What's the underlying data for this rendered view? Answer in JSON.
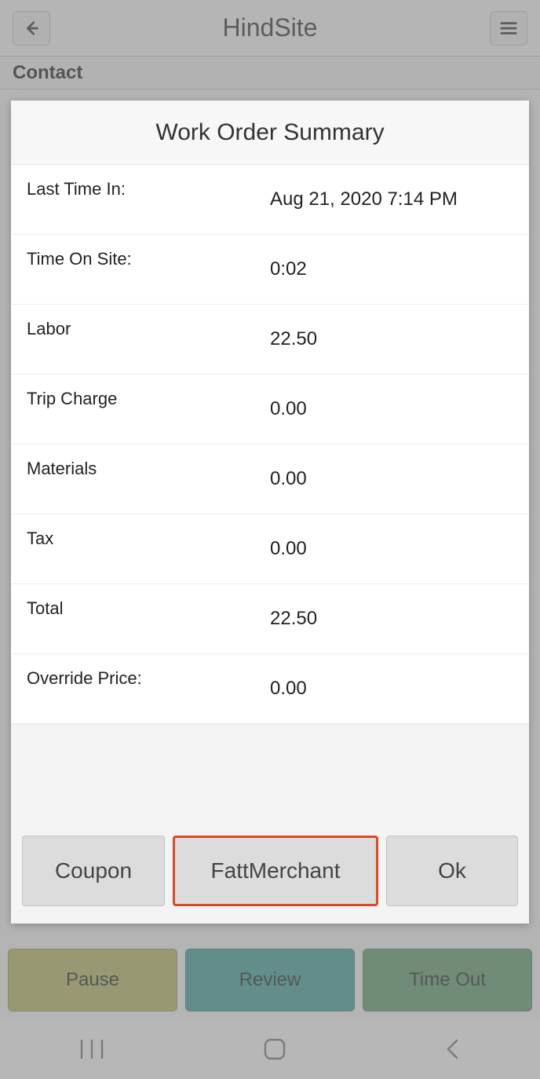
{
  "header": {
    "title": "HindSite"
  },
  "contact": {
    "label": "Contact"
  },
  "modal": {
    "title": "Work Order Summary",
    "rows": [
      {
        "label": "Last Time In:",
        "value": "Aug 21, 2020 7:14 PM"
      },
      {
        "label": "Time On Site:",
        "value": "0:02"
      },
      {
        "label": "Labor",
        "value": "22.50"
      },
      {
        "label": "Trip Charge",
        "value": "0.00"
      },
      {
        "label": "Materials",
        "value": "0.00"
      },
      {
        "label": "Tax",
        "value": "0.00"
      },
      {
        "label": "Total",
        "value": "22.50"
      },
      {
        "label": "Override Price:",
        "value": "0.00"
      }
    ],
    "buttons": {
      "coupon": "Coupon",
      "fattmerchant": "FattMerchant",
      "ok": "Ok"
    }
  },
  "footer": {
    "pause": "Pause",
    "review": "Review",
    "timeout": "Time Out"
  }
}
